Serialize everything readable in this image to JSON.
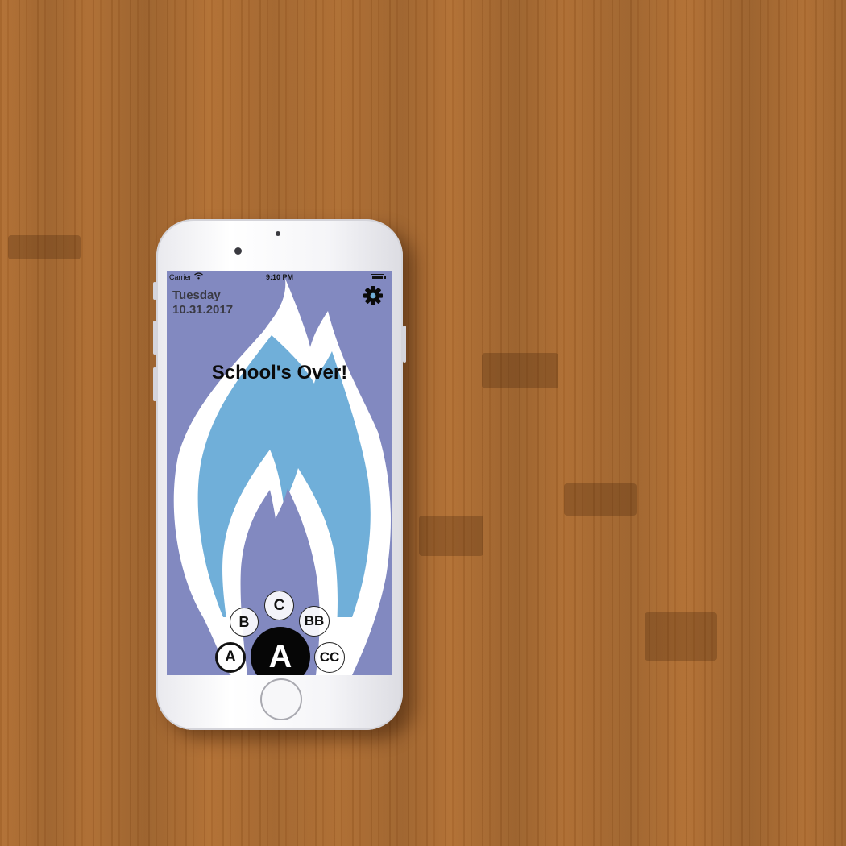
{
  "status_bar": {
    "carrier": "Carrier",
    "time": "9:10 PM"
  },
  "header": {
    "day": "Tuesday",
    "date": "10.31.2017"
  },
  "message": "School's Over!",
  "schedule_bubbles": {
    "a_small": "A",
    "b": "B",
    "c": "C",
    "bb": "BB",
    "a_main": "A",
    "cc": "CC"
  },
  "colors": {
    "screen_background": "#8289c0",
    "flame_outline": "#ffffff",
    "flame_fill": "#70afd9",
    "inner_flame": "#8289c0",
    "active_bubble": "#060606"
  },
  "icons": {
    "settings": "gear-icon",
    "wifi": "wifi-icon",
    "battery": "battery-icon"
  }
}
